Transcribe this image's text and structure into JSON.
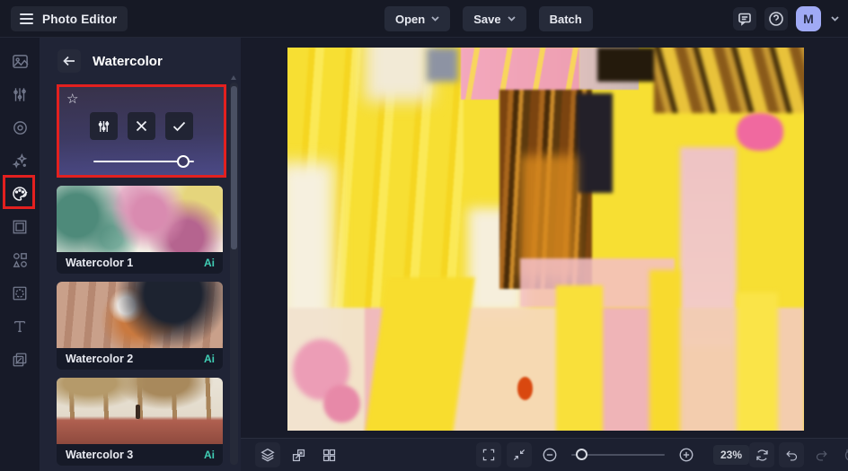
{
  "topbar": {
    "app_title": "Photo Editor",
    "open_label": "Open",
    "save_label": "Save",
    "batch_label": "Batch",
    "avatar_initial": "M"
  },
  "sidebar": {
    "items": [
      {
        "icon": "image-icon"
      },
      {
        "icon": "sliders-icon"
      },
      {
        "icon": "eye-icon"
      },
      {
        "icon": "sparkles-icon"
      },
      {
        "icon": "palette-icon",
        "selected": true,
        "highlight": "red-box"
      },
      {
        "icon": "frame-icon"
      },
      {
        "icon": "shapes-icon"
      },
      {
        "icon": "overlay-icon"
      },
      {
        "icon": "text-icon"
      },
      {
        "icon": "layers-copy-icon"
      }
    ]
  },
  "panel": {
    "title": "Watercolor",
    "selected_filter": {
      "favorite_icon": "star-icon",
      "actions": [
        "adjust-sliders-icon",
        "cancel-x-icon",
        "confirm-check-icon"
      ],
      "intensity_slider_position": "83%",
      "highlight": "red-box"
    },
    "filters": [
      {
        "label": "Watercolor 1",
        "badge": "Ai"
      },
      {
        "label": "Watercolor 2",
        "badge": "Ai"
      },
      {
        "label": "Watercolor 3",
        "badge": "Ai"
      }
    ]
  },
  "bottombar": {
    "zoom_level": "23%",
    "zoom_slider_position": "5%"
  },
  "colors": {
    "accent_red": "#e3201f",
    "ai_badge": "#40cdb4",
    "avatar_bg": "#a0aaf5",
    "topbar_bg": "#161925",
    "panel_bg": "#202436",
    "canvas_bg": "#181b29"
  }
}
